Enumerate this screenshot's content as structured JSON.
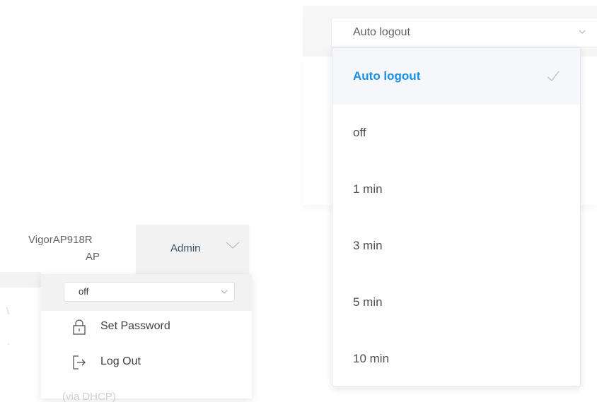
{
  "auto_logout_select": {
    "value": "Auto logout",
    "options": [
      {
        "label": "Auto logout",
        "selected": true
      },
      {
        "label": "off",
        "selected": false
      },
      {
        "label": "1 min",
        "selected": false
      },
      {
        "label": "3 min",
        "selected": false
      },
      {
        "label": "5 min",
        "selected": false
      },
      {
        "label": "10 min",
        "selected": false
      }
    ]
  },
  "header": {
    "device_name": "VigorAP918R",
    "device_role": "AP",
    "user_label": "Admin"
  },
  "admin_menu": {
    "auto_logout_value": "off",
    "items": [
      {
        "label": "Set Password",
        "icon": "lock-icon"
      },
      {
        "label": "Log Out",
        "icon": "logout-icon"
      }
    ]
  },
  "background_fragments": {
    "bottom_text": "(via DHCP)"
  },
  "colors": {
    "accent": "#1890e8",
    "selected_bg": "#f5f7fa",
    "header_bg": "#f2f2f2"
  }
}
